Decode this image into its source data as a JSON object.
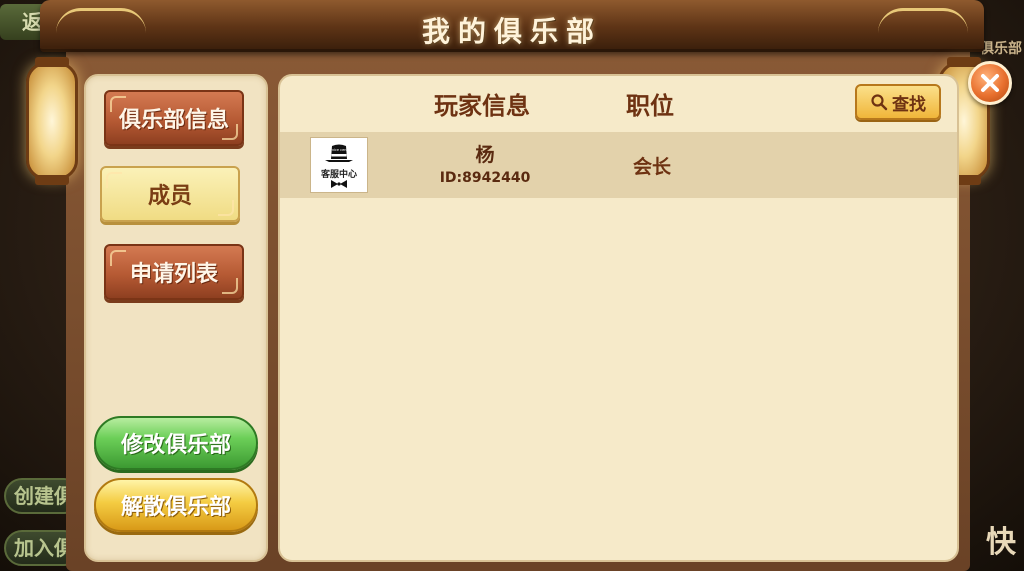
{
  "title": "我的俱乐部",
  "background": {
    "back_label": "返",
    "create_label": "创建俱",
    "join_label": "加入俱",
    "right_label": "俱乐部",
    "right_bottom": "快"
  },
  "sidebar": {
    "items": [
      {
        "label": "俱乐部信息",
        "active": false
      },
      {
        "label": "成员",
        "active": true
      },
      {
        "label": "申请列表",
        "active": false
      }
    ],
    "modify_label": "修改俱乐部",
    "dissolve_label": "解散俱乐部"
  },
  "main": {
    "columns": {
      "player_info": "玩家信息",
      "position": "职位"
    },
    "search_label": "查找",
    "members": [
      {
        "avatar_text": "客服中心",
        "name": "杨",
        "id": "ID:8942440",
        "role": "会长"
      }
    ]
  },
  "colors": {
    "accent": "#b65a34",
    "active": "#f0dc84",
    "panel": "#f6eac9"
  }
}
